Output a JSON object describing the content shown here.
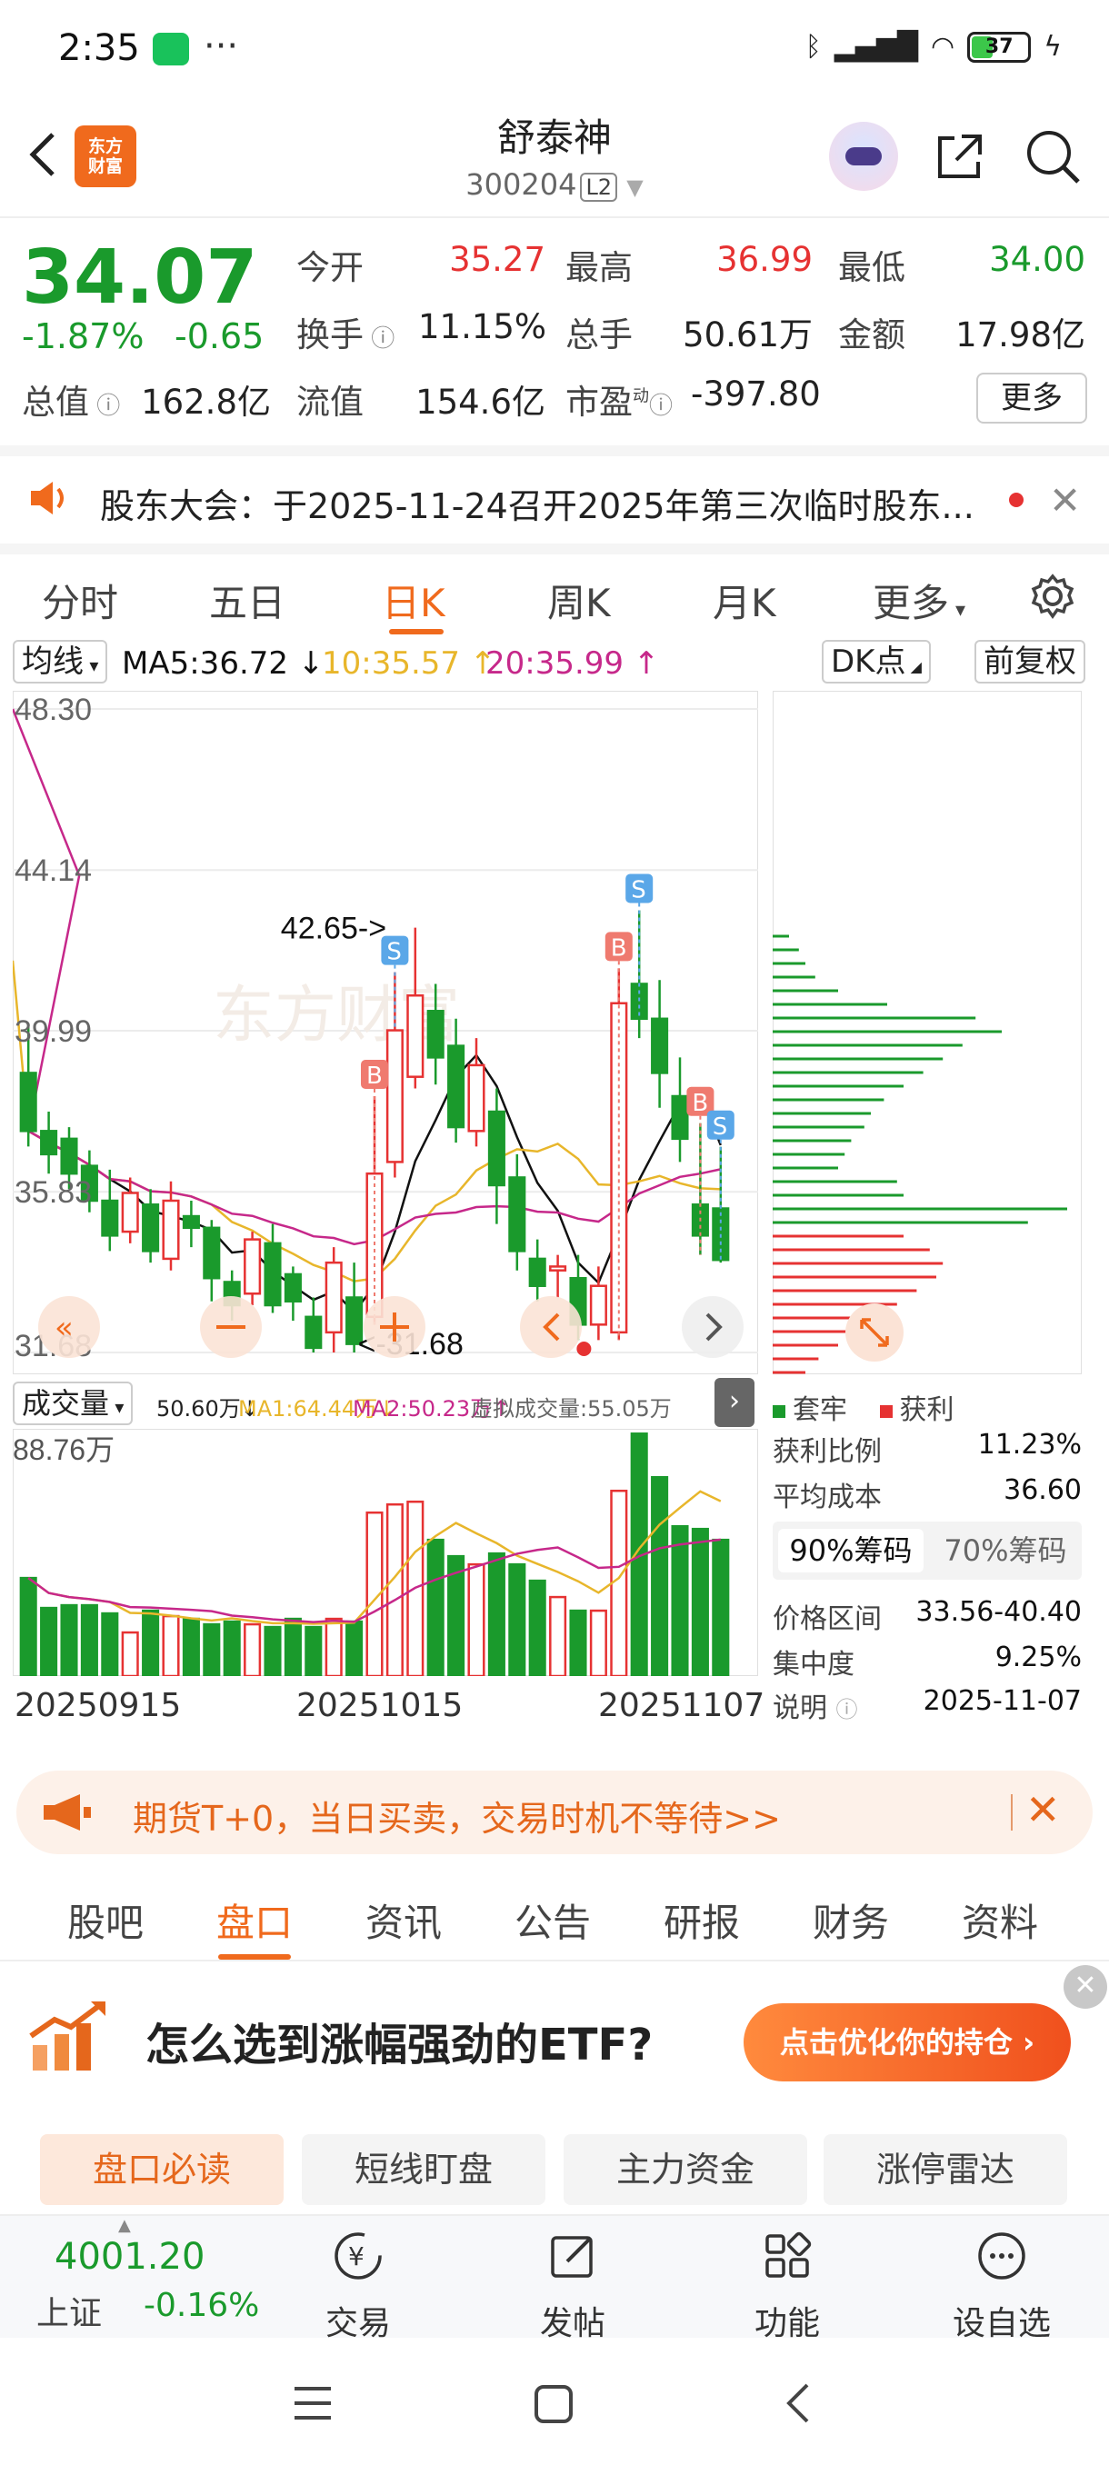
{
  "status_bar": {
    "time": "2:35",
    "dots": "···",
    "battery": "37"
  },
  "header": {
    "title": "舒泰神",
    "code": "300204",
    "level": "L2",
    "logo": "东方财富"
  },
  "quote": {
    "price": "34.07",
    "pct": "-1.87%",
    "chg": "-0.65",
    "fields": [
      {
        "label": "今开",
        "value": "35.27",
        "color": "#e63232"
      },
      {
        "label": "最高",
        "value": "36.99",
        "color": "#e63232"
      },
      {
        "label": "最低",
        "value": "34.00",
        "color": "#1a9a2c"
      },
      {
        "label": "换手",
        "value": "11.15%",
        "color": "#222222"
      },
      {
        "label": "总手",
        "value": "50.61万",
        "color": "#222222"
      },
      {
        "label": "金额",
        "value": "17.98亿",
        "color": "#222222"
      },
      {
        "label": "总值",
        "value": "162.8亿",
        "color": "#222222"
      },
      {
        "label": "流值",
        "value": "154.6亿",
        "color": "#222222"
      },
      {
        "label": "市盈",
        "value": "-397.80",
        "color": "#222222"
      }
    ],
    "pe_sup": "动",
    "more": "更多"
  },
  "notice": {
    "text": "股东大会：于2025-11-24召开2025年第三次临时股东..."
  },
  "period_tabs": [
    "分时",
    "五日",
    "日K",
    "周K",
    "月K",
    "更多"
  ],
  "indicator": {
    "type": "均线",
    "ma5": "MA5:36.72",
    "ma10": "10:35.57",
    "ma20": "20:35.99",
    "dk": "DK点",
    "adjust": "前复权"
  },
  "chart_data": [
    {
      "type": "candlestick",
      "title": "日K",
      "y_ticks": [
        "48.30",
        "44.14",
        "39.99",
        "35.83",
        "31.68"
      ],
      "ylim": [
        31.68,
        48.3
      ],
      "annotations": [
        "42.65->",
        "<-31.68"
      ],
      "markers": [
        "B",
        "S",
        "B",
        "S",
        "B",
        "S"
      ],
      "candles": [
        {
          "o": 38.9,
          "c": 37.4,
          "h": 40.1,
          "l": 37.0
        },
        {
          "o": 37.4,
          "c": 36.8,
          "h": 37.9,
          "l": 36.3
        },
        {
          "o": 37.2,
          "c": 36.3,
          "h": 37.5,
          "l": 35.9
        },
        {
          "o": 36.5,
          "c": 35.6,
          "h": 36.9,
          "l": 35.3
        },
        {
          "o": 35.6,
          "c": 34.7,
          "h": 36.4,
          "l": 34.3
        },
        {
          "o": 34.8,
          "c": 35.8,
          "h": 36.2,
          "l": 34.5
        },
        {
          "o": 35.5,
          "c": 34.3,
          "h": 35.9,
          "l": 34.0
        },
        {
          "o": 34.1,
          "c": 35.6,
          "h": 36.1,
          "l": 33.8
        },
        {
          "o": 35.2,
          "c": 34.9,
          "h": 35.6,
          "l": 34.4
        },
        {
          "o": 34.9,
          "c": 33.6,
          "h": 35.1,
          "l": 33.0
        },
        {
          "o": 33.5,
          "c": 32.9,
          "h": 33.8,
          "l": 32.5
        },
        {
          "o": 33.2,
          "c": 34.6,
          "h": 34.8,
          "l": 32.9
        },
        {
          "o": 34.5,
          "c": 32.9,
          "h": 35.0,
          "l": 32.7
        },
        {
          "o": 33.7,
          "c": 33.0,
          "h": 33.9,
          "l": 32.5
        },
        {
          "o": 32.6,
          "c": 31.8,
          "h": 33.1,
          "l": 31.68
        },
        {
          "o": 32.2,
          "c": 34.0,
          "h": 34.4,
          "l": 31.68
        },
        {
          "o": 33.1,
          "c": 31.9,
          "h": 34.0,
          "l": 31.68
        },
        {
          "o": 32.6,
          "c": 36.3,
          "h": 38.3,
          "l": 32.4
        },
        {
          "o": 36.6,
          "c": 40.0,
          "h": 41.5,
          "l": 36.2
        },
        {
          "o": 38.8,
          "c": 40.9,
          "h": 42.65,
          "l": 38.5
        },
        {
          "o": 40.5,
          "c": 39.3,
          "h": 41.2,
          "l": 38.6
        },
        {
          "o": 39.6,
          "c": 37.5,
          "h": 40.3,
          "l": 37.1
        },
        {
          "o": 37.4,
          "c": 39.1,
          "h": 39.8,
          "l": 37.0
        },
        {
          "o": 37.9,
          "c": 36.0,
          "h": 38.5,
          "l": 35.0
        },
        {
          "o": 36.2,
          "c": 34.3,
          "h": 36.8,
          "l": 33.8
        },
        {
          "o": 34.1,
          "c": 33.4,
          "h": 34.6,
          "l": 33.0
        },
        {
          "o": 33.8,
          "c": 33.9,
          "h": 34.2,
          "l": 33.1
        },
        {
          "o": 33.6,
          "c": 32.4,
          "h": 34.2,
          "l": 32.0
        },
        {
          "o": 32.4,
          "c": 33.4,
          "h": 33.9,
          "l": 32.0
        },
        {
          "o": 32.2,
          "c": 40.7,
          "h": 41.6,
          "l": 32.0
        },
        {
          "o": 41.2,
          "c": 40.3,
          "h": 43.1,
          "l": 39.8
        },
        {
          "o": 40.3,
          "c": 38.9,
          "h": 41.3,
          "l": 38.0
        },
        {
          "o": 38.3,
          "c": 37.2,
          "h": 39.3,
          "l": 36.6
        },
        {
          "o": 35.5,
          "c": 34.7,
          "h": 37.6,
          "l": 34.2
        },
        {
          "o": 35.4,
          "c": 34.07,
          "h": 36.99,
          "l": 34.0
        }
      ]
    },
    {
      "type": "bar",
      "title": "成交量",
      "header_value": "50.60万",
      "ma1": "MA1:64.44万",
      "ma2": "MA2:50.23万",
      "virtual": "虚拟成交量:55.05万",
      "y_max_label": "88.76万",
      "ylim": [
        0,
        88.76
      ],
      "x_ticks": [
        "20250915",
        "20251015",
        "20251107"
      ],
      "values": [
        36,
        25,
        26,
        26,
        23,
        16,
        24,
        22,
        21,
        19,
        20,
        19,
        18,
        21,
        18,
        21,
        20,
        60,
        63,
        64,
        50,
        44,
        41,
        45,
        41,
        35,
        29,
        24,
        24,
        68,
        89,
        73,
        55,
        54,
        50
      ]
    },
    {
      "type": "bar",
      "title": "筹码分布",
      "values_green": [
        5,
        8,
        10,
        13,
        20,
        35,
        62,
        70,
        58,
        52,
        46,
        40,
        34,
        30,
        28,
        24,
        22,
        20,
        38,
        40,
        90,
        78
      ],
      "values_red": [
        40,
        48,
        52,
        50,
        44,
        38,
        32,
        26,
        20,
        14,
        10
      ]
    }
  ],
  "volume_bar": {
    "label": "成交量",
    "value": "50.60万",
    "ma1": "MA1:64.44万",
    "ma2": "MA2:50.23万",
    "virtual": "虚拟成交量:55.05万"
  },
  "distribution": {
    "legend_trapped": "套牢",
    "legend_profit": "获利",
    "profit_ratio_label": "获利比例",
    "profit_ratio": "11.23%",
    "avg_cost_label": "平均成本",
    "avg_cost": "36.60",
    "tab_90": "90%筹码",
    "tab_70": "70%筹码",
    "range_label": "价格区间",
    "range": "33.56-40.40",
    "concentration_label": "集中度",
    "concentration": "9.25%",
    "note_label": "说明",
    "note_date": "2025-11-07"
  },
  "promo": {
    "text": "期货T+0，当日买卖，交易时机不等待>>"
  },
  "section_tabs": [
    "股吧",
    "盘口",
    "资讯",
    "公告",
    "研报",
    "财务",
    "资料"
  ],
  "etf": {
    "text": "怎么选到涨幅强劲的ETF?",
    "button": "点击优化你的持仓 ›"
  },
  "quick_tabs": [
    "盘口必读",
    "短线盯盘",
    "主力资金",
    "涨停雷达"
  ],
  "bottom_bar": {
    "index_value": "4001.20",
    "index_name": "上证",
    "index_pct": "-0.16%",
    "items": [
      "交易",
      "发帖",
      "功能",
      "设自选"
    ]
  },
  "colors": {
    "accent": "#f06a1d",
    "up": "#e63232",
    "down": "#1a9a2c",
    "ma5": "#111111",
    "ma10": "#e8b62b",
    "ma20": "#c6288a"
  }
}
